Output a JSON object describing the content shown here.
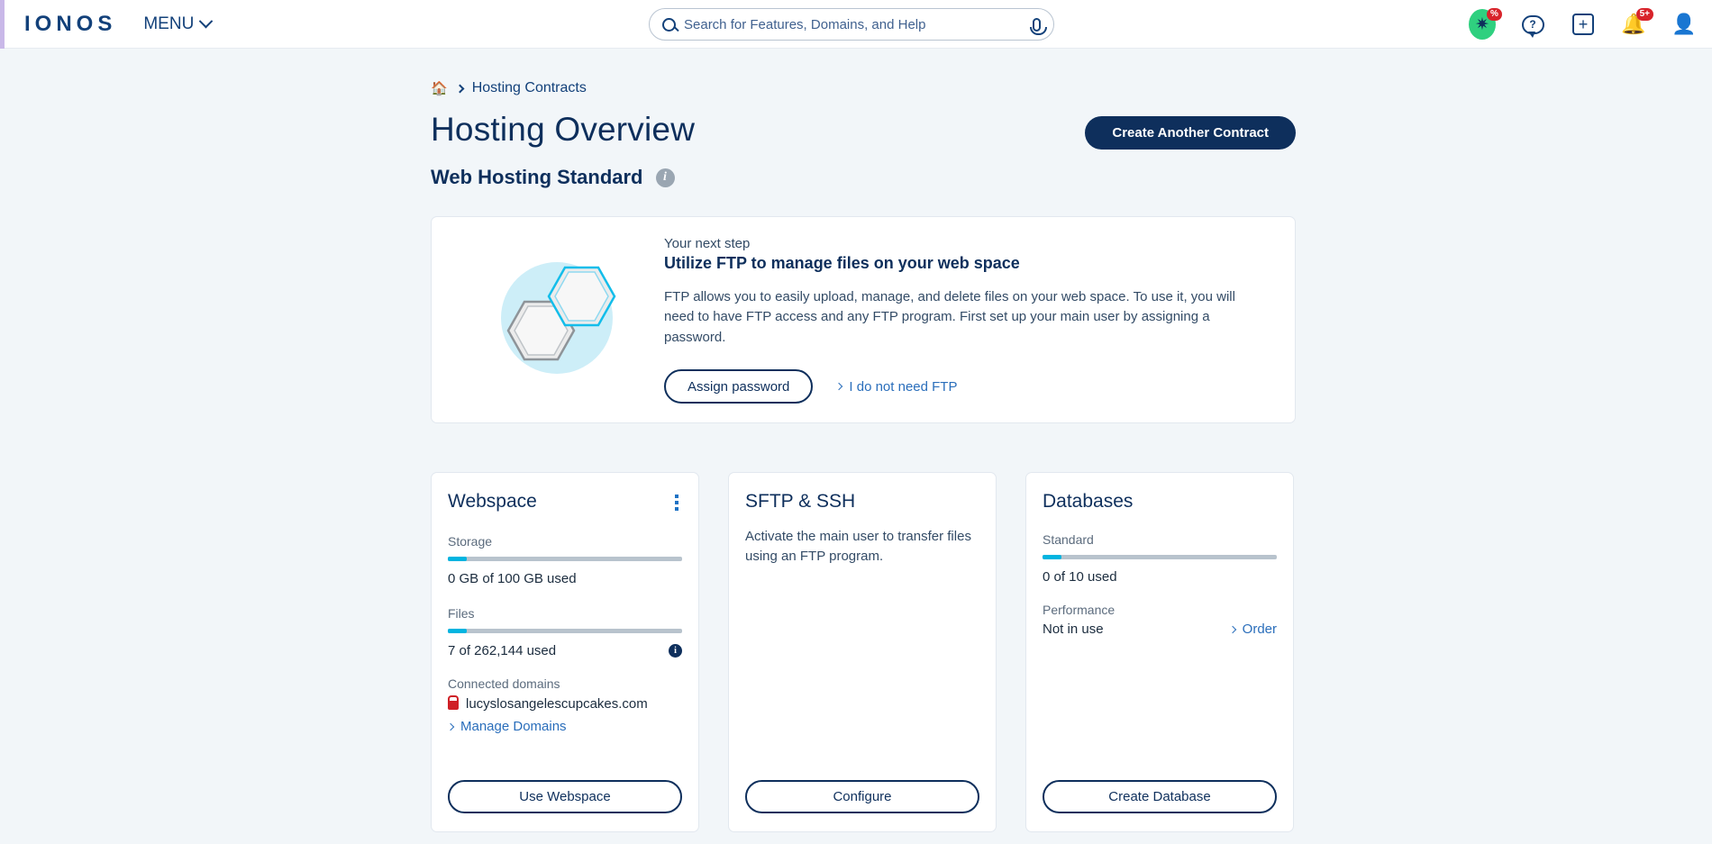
{
  "topbar": {
    "logo": "IONOS",
    "menu_label": "MENU",
    "search": {
      "placeholder": "Search for Features, Domains, and Help",
      "value": ""
    },
    "icons": {
      "search": "search-icon",
      "mic": "microphone-icon",
      "deals": "star-deals-icon",
      "deals_badge": "%",
      "help": "help-question-icon",
      "add": "plus-icon",
      "notifications": "bell-icon",
      "notifications_badge": "5+",
      "account": "user-account-icon"
    }
  },
  "breadcrumb": {
    "home": "⌂",
    "item": "Hosting Contracts"
  },
  "header": {
    "title": "Hosting Overview",
    "subtitle": "Web Hosting Standard",
    "info_glyph": "i",
    "create_contract_label": "Create Another Contract"
  },
  "next_step": {
    "eyebrow": "Your next step",
    "heading": "Utilize FTP to manage files on your web space",
    "body": "FTP allows you to easily upload, manage, and delete files on your web space. To use it, you will need to have FTP access and any FTP program. First set up your main user by assigning a password.",
    "primary_label": "Assign password",
    "link_label": "I do not need FTP",
    "illustration": "hexagons-illustration"
  },
  "cards": {
    "webspace": {
      "title": "Webspace",
      "menu": "kebab-menu-icon",
      "storage_label": "Storage",
      "storage_percent": 8,
      "storage_value": "0 GB of 100 GB used",
      "files_label": "Files",
      "files_percent": 8,
      "files_value": "7 of 262,144 used",
      "files_info_glyph": "i",
      "domains_label": "Connected domains",
      "domain": "lucyslosangelescupcakes.com",
      "domain_lock": "lock-icon",
      "manage_link": "Manage Domains",
      "button_label": "Use Webspace"
    },
    "sftp": {
      "title": "SFTP & SSH",
      "description": "Activate the main user to transfer files using an FTP program.",
      "button_label": "Configure"
    },
    "databases": {
      "title": "Databases",
      "standard_label": "Standard",
      "standard_percent": 8,
      "standard_value": "0 of 10 used",
      "performance_label": "Performance",
      "performance_value": "Not in use",
      "order_link": "Order",
      "button_label": "Create Database"
    }
  },
  "colors": {
    "brand_navy": "#0e2f5c",
    "link_blue": "#2a6ebb",
    "accent_cyan": "#00b4e0",
    "deal_green": "#2fd07f",
    "badge_red": "#d8232a",
    "lock_red": "#cf2026",
    "page_bg": "#f2f6f9"
  }
}
